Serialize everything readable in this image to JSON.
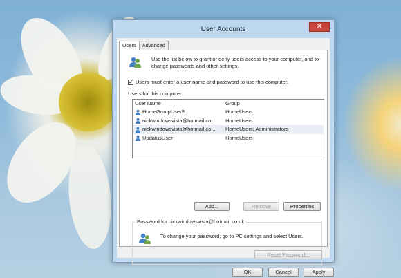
{
  "window": {
    "title": "User Accounts",
    "close_label": "✕"
  },
  "tabs": [
    {
      "label": "Users"
    },
    {
      "label": "Advanced"
    }
  ],
  "intro": "Use the list below to grant or deny users access to your computer, and to change passwords and other settings.",
  "checkbox": {
    "checked_mark": "✓",
    "label": "Users must enter a user name and password to use this computer."
  },
  "users_section": {
    "label": "Users for this computer:",
    "headers": {
      "name": "User Name",
      "group": "Group"
    },
    "rows": [
      {
        "name": "HomeGroupUser$",
        "group": "HomeUsers"
      },
      {
        "name": "nickwindowsvista@hotmail.co...",
        "group": "HomeUsers"
      },
      {
        "name": "nickwindowsvista@hotmail.co...",
        "group": "HomeUsers; Administrators"
      },
      {
        "name": "UpdatusUser",
        "group": "HomeUsers"
      }
    ]
  },
  "buttons": {
    "add": "Add...",
    "remove": "Remove",
    "properties": "Properties",
    "reset_password": "Reset Password...",
    "ok": "OK",
    "cancel": "Cancel",
    "apply": "Apply"
  },
  "password_section": {
    "label": "Password for nickwindowsvista@hotmail.co.uk",
    "text": "To change your password, go to PC settings and select Users."
  },
  "icons": {
    "users": "users-icon",
    "user": "user-icon",
    "password": "password-users-icon"
  },
  "colors": {
    "close": "#c9463d",
    "selected_row": "#e8eef4"
  }
}
